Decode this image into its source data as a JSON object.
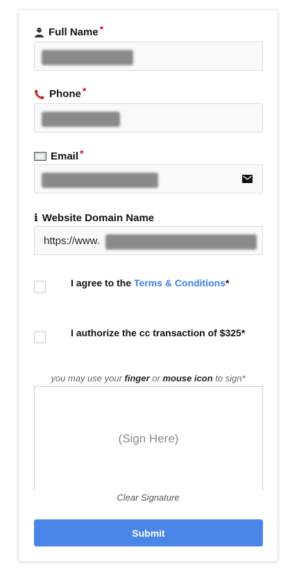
{
  "form": {
    "full_name": {
      "label": "Full Name",
      "required_mark": "*",
      "icon": "person-icon"
    },
    "phone": {
      "label": "Phone",
      "required_mark": "*",
      "icon": "phone-icon"
    },
    "email": {
      "label": "Email",
      "required_mark": "*",
      "icon": "envelope-icon",
      "field_icon": "mail-icon"
    },
    "website": {
      "label": "Website Domain Name",
      "icon_glyph": "i",
      "prefix": "https://www."
    },
    "terms": {
      "text_before": "I agree to the ",
      "link": "Terms & Conditions",
      "required_mark": "*"
    },
    "authorize": {
      "text": "I authorize the cc transaction of $325*"
    },
    "signature": {
      "hint_1": "you may use your ",
      "hint_finger": "finger",
      "hint_2": " or ",
      "hint_mouse": "mouse icon",
      "hint_3": " to sign*",
      "placeholder": "(Sign Here)",
      "clear_label": "Clear Signature"
    },
    "submit_label": "Submit"
  }
}
